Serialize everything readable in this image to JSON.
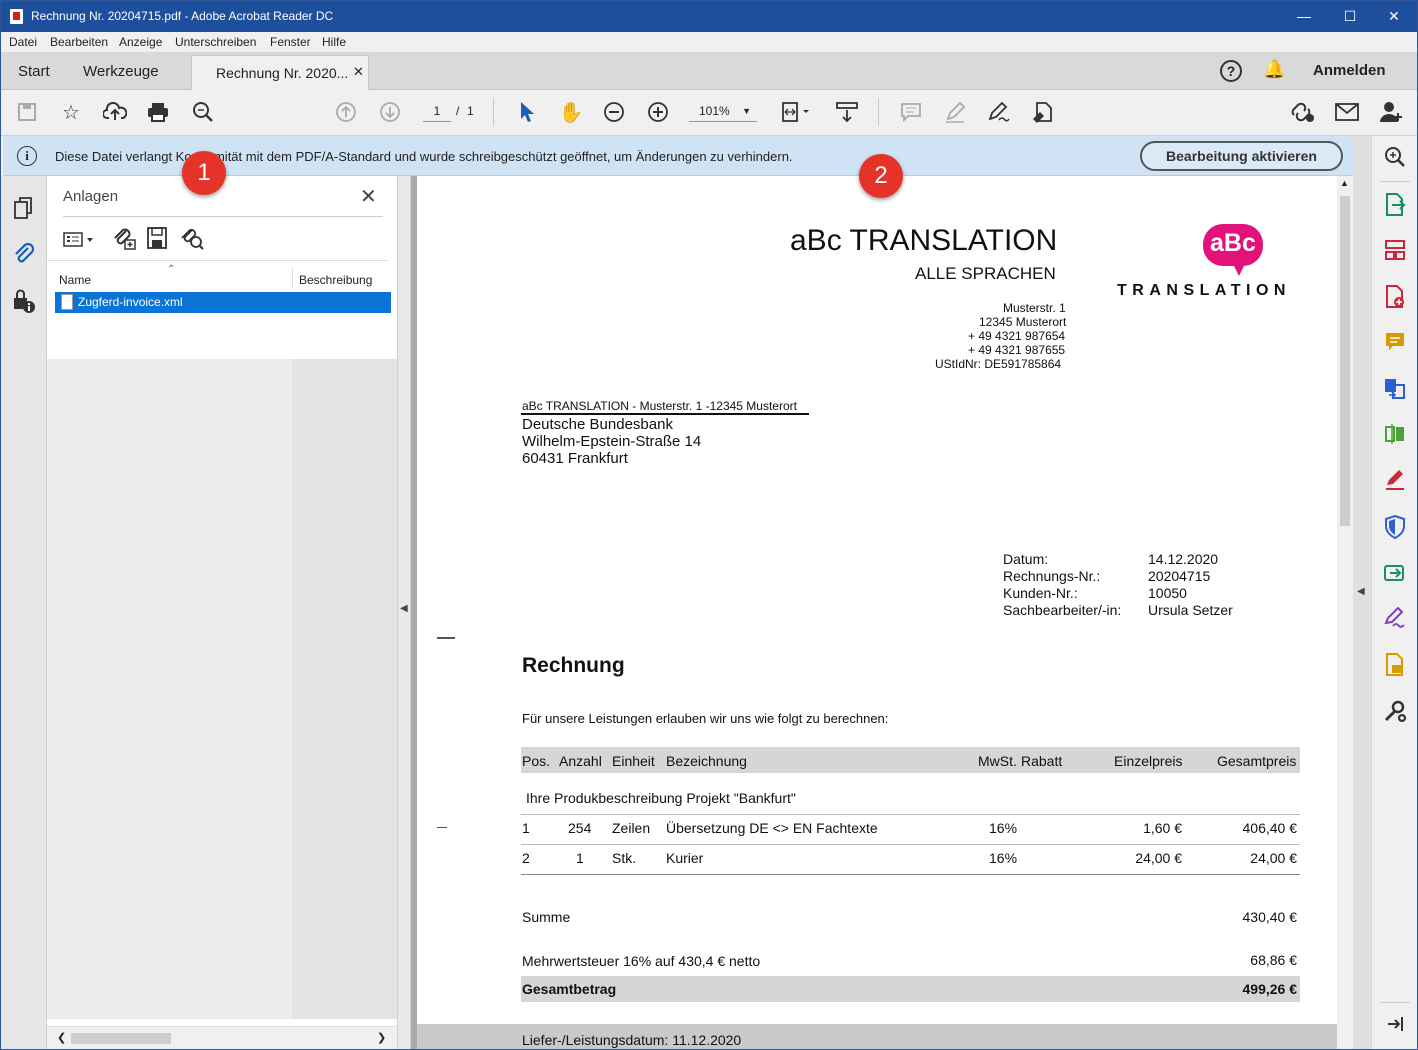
{
  "window": {
    "title": "Rechnung Nr. 20204715.pdf - Adobe Acrobat Reader DC"
  },
  "menu": [
    "Datei",
    "Bearbeiten",
    "Anzeige",
    "Unterschreiben",
    "Fenster",
    "Hilfe"
  ],
  "tabs": {
    "start": "Start",
    "tools": "Werkzeuge",
    "doc": "Rechnung Nr. 2020...",
    "signin": "Anmelden"
  },
  "toolbar": {
    "page_current": "1",
    "page_sep": "/",
    "page_total": "1",
    "zoom": "101%"
  },
  "infobar": {
    "message": "Diese Datei verlangt Konformität mit dem PDF/A-Standard und wurde schreibgeschützt geöffnet, um Änderungen zu verhindern.",
    "button": "Bearbeitung aktivieren"
  },
  "badges": {
    "one": "1",
    "two": "2"
  },
  "attachments": {
    "title": "Anlagen",
    "col_name": "Name",
    "col_desc": "Beschreibung",
    "items": [
      {
        "name": "Zugferd-invoice.xml",
        "desc": ""
      }
    ]
  },
  "invoice": {
    "company": "aBc TRANSLATION",
    "tagline": "ALLE SPRACHEN",
    "logo_mark": "aBc",
    "logo_word": "TRANSLATION",
    "address": [
      "Musterstr. 1",
      "12345 Musterort",
      "+ 49 4321 987654",
      "+ 49 4321 987655",
      "UStIdNr: DE591785864"
    ],
    "sender_line": "aBc TRANSLATION - Musterstr. 1 -12345 Musterort",
    "recipient": [
      "Deutsche Bundesbank",
      "Wilhelm-Epstein-Straße 14",
      "60431 Frankfurt"
    ],
    "meta_labels": [
      "Datum:",
      "Rechnungs-Nr.:",
      "Kunden-Nr.:",
      "Sachbearbeiter/-in:"
    ],
    "meta_values": [
      "14.12.2020",
      "20204715",
      "10050",
      "Ursula Setzer"
    ],
    "heading": "Rechnung",
    "intro": "Für unsere Leistungen erlauben wir uns wie folgt zu berechnen:",
    "columns": [
      "Pos.",
      "Anzahl",
      "Einheit",
      "Bezeichnung",
      "MwSt.",
      "Rabatt",
      "Einzelpreis",
      "Gesamtpreis"
    ],
    "project_line": "Ihre Produkbeschreibung Projekt \"Bankfurt\"",
    "rows": [
      {
        "pos": "1",
        "qty": "254",
        "unit": "Zeilen",
        "desc": "Übersetzung DE <> EN Fachtexte",
        "vat": "16%",
        "price": "1,60 €",
        "total": "406,40 €"
      },
      {
        "pos": "2",
        "qty": "1",
        "unit": "Stk.",
        "desc": "Kurier",
        "vat": "16%",
        "price": "24,00 €",
        "total": "24,00 €"
      }
    ],
    "sum_label": "Summe",
    "sum_value": "430,40 €",
    "vat_label": "Mehrwertsteuer 16% auf 430,4 € netto",
    "vat_value": "68,86 €",
    "total_label": "Gesamtbetrag",
    "total_value": "499,26 €",
    "delivery": "Liefer-/Leistungsdatum: 11.12.2020"
  },
  "colors": {
    "titlebar": "#1e4f9c",
    "infobar": "#cfe3f5",
    "selection": "#0a74d6",
    "logo": "#e2127a",
    "badge": "#e5332a"
  }
}
